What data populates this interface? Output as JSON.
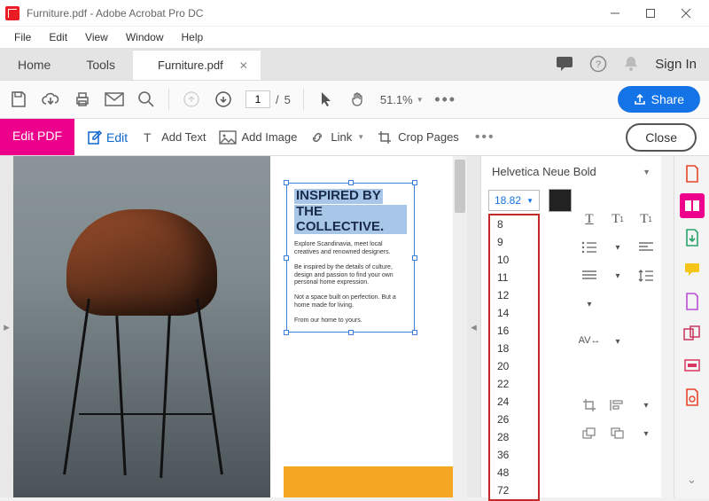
{
  "window": {
    "title": "Furniture.pdf - Adobe Acrobat Pro DC"
  },
  "menu": {
    "file": "File",
    "edit": "Edit",
    "view": "View",
    "window": "Window",
    "help": "Help"
  },
  "tabs": {
    "home": "Home",
    "tools": "Tools",
    "doc": "Furniture.pdf",
    "signin": "Sign In"
  },
  "toolbar": {
    "page_current": "1",
    "page_sep": "/",
    "page_total": "5",
    "zoom": "51.1%",
    "share": "Share"
  },
  "editbar": {
    "title": "Edit PDF",
    "edit": "Edit",
    "addtext": "Add Text",
    "addimage": "Add Image",
    "link": "Link",
    "crop": "Crop Pages",
    "close": "Close"
  },
  "doc": {
    "headline1": "INSPIRED BY",
    "headline2": "THE COLLECTIVE.",
    "p1": "Explore Scandinavia, meet local creatives and renowned designers.",
    "p2": "Be inspired by the details of culture, design and passion to find your own personal home expression.",
    "p3": "Not a space built on perfection. But a home made for living.",
    "p4": "From our home to yours."
  },
  "format": {
    "font": "Helvetica Neue Bold",
    "size_value": "18.82",
    "sizes": [
      "8",
      "9",
      "10",
      "11",
      "12",
      "14",
      "16",
      "18",
      "20",
      "22",
      "24",
      "26",
      "28",
      "36",
      "48",
      "72"
    ]
  }
}
